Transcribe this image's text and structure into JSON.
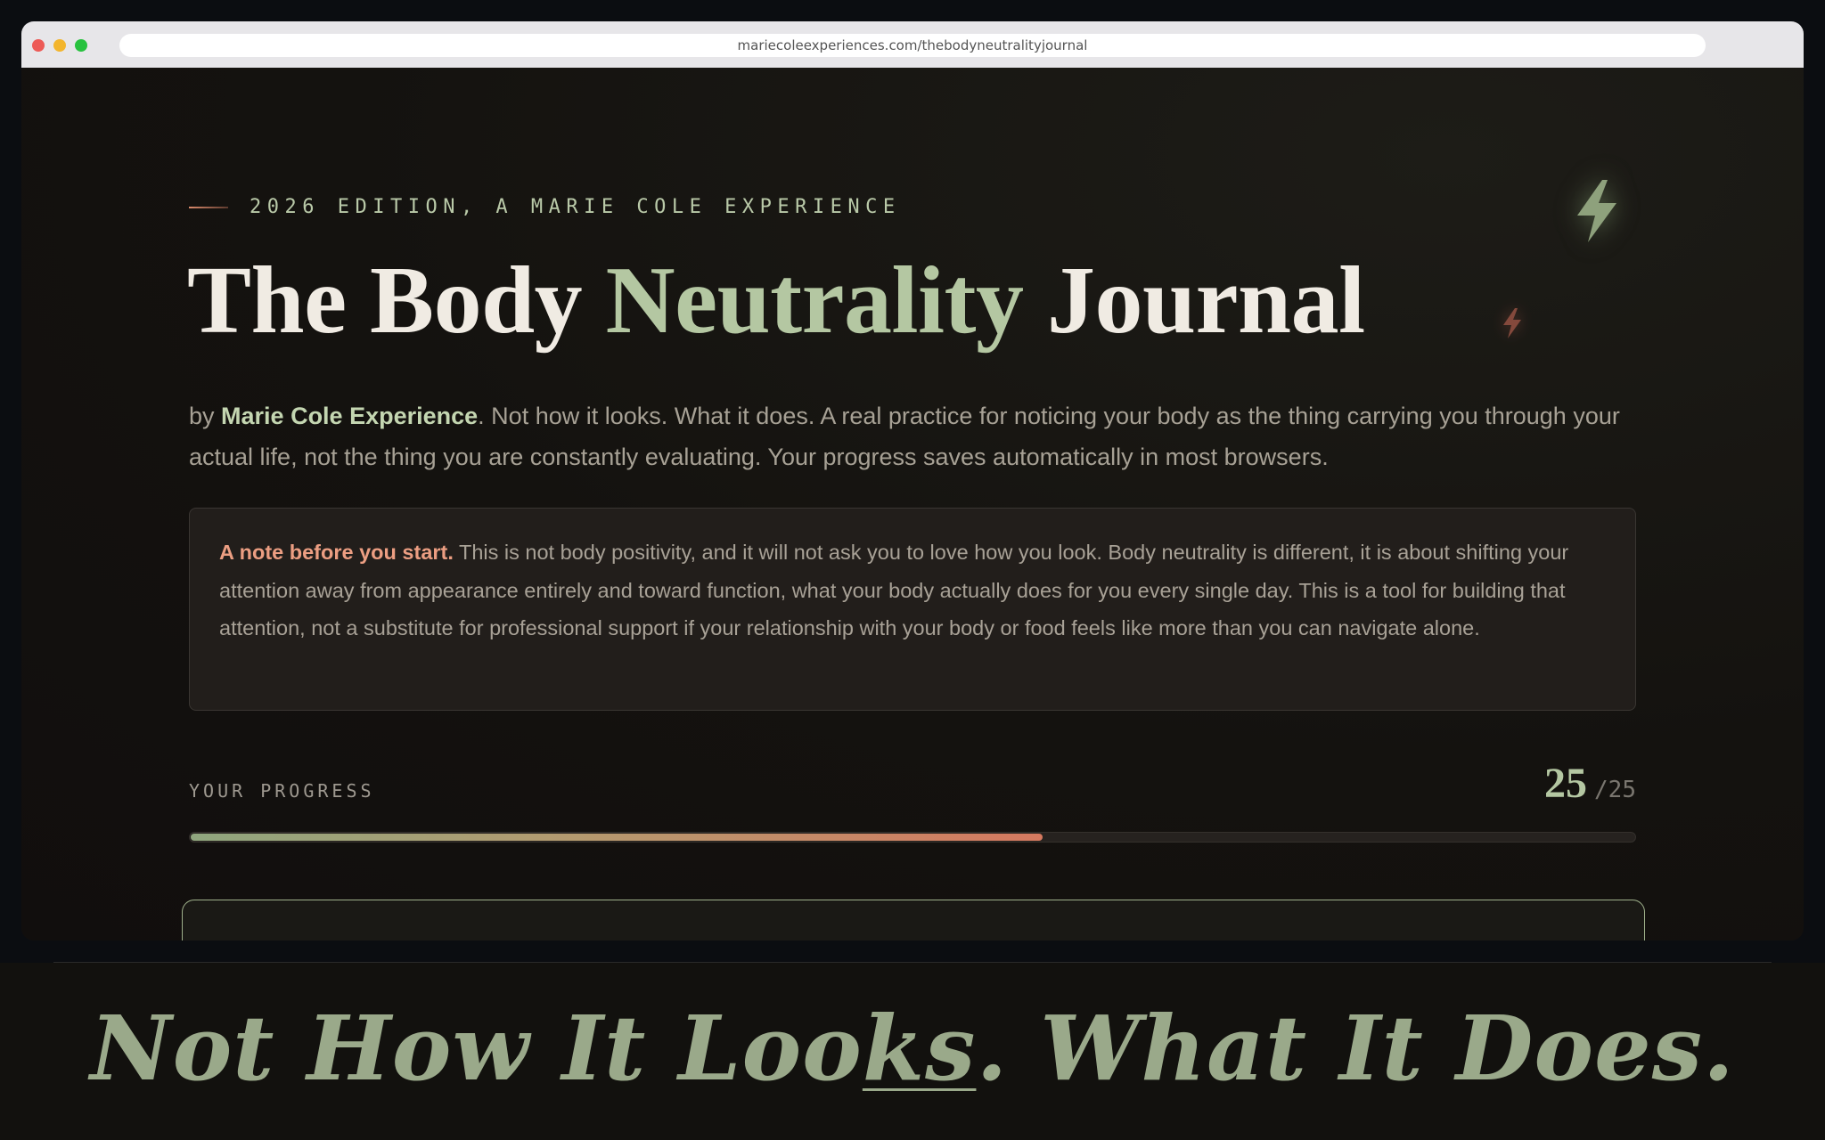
{
  "browser": {
    "url": "mariecoleexperiences.com/thebodyneutralityjournal"
  },
  "hero": {
    "eyebrow": "2026 EDITION, A MARIE COLE EXPERIENCE",
    "title_part1": "The Body ",
    "title_accent": "Neutrality",
    "title_part2": " Journal",
    "byline_prefix": "by ",
    "byline_author": "Marie Cole Experience",
    "byline_rest": ". Not how it looks. What it does. A real practice for noticing your body as the thing carrying you through your actual life, not the thing you are constantly evaluating. Your progress saves automatically in most browsers."
  },
  "note": {
    "lead": "A note before you start.",
    "body": " This is not body positivity, and it will not ask you to love how you look. Body neutrality is different, it is about shifting your attention away from appearance entirely and toward function, what your body actually does for you every single day. This is a tool for building that attention, not a substitute for professional support if your relationship with your body or food feels like more than you can navigate alone."
  },
  "progress": {
    "label": "YOUR PROGRESS",
    "count": "25",
    "total": "/25",
    "fill_fraction": 0.59
  },
  "caption": {
    "part1": "Not How It Loo",
    "underlined": "ks",
    "part2": ". What It Does."
  },
  "colors": {
    "accent_green": "#b4c7a2",
    "accent_coral": "#ec9e82",
    "background": "#13110f"
  },
  "icons": [
    "lightning-bolt-icon",
    "small-lightning-bolt-icon"
  ]
}
